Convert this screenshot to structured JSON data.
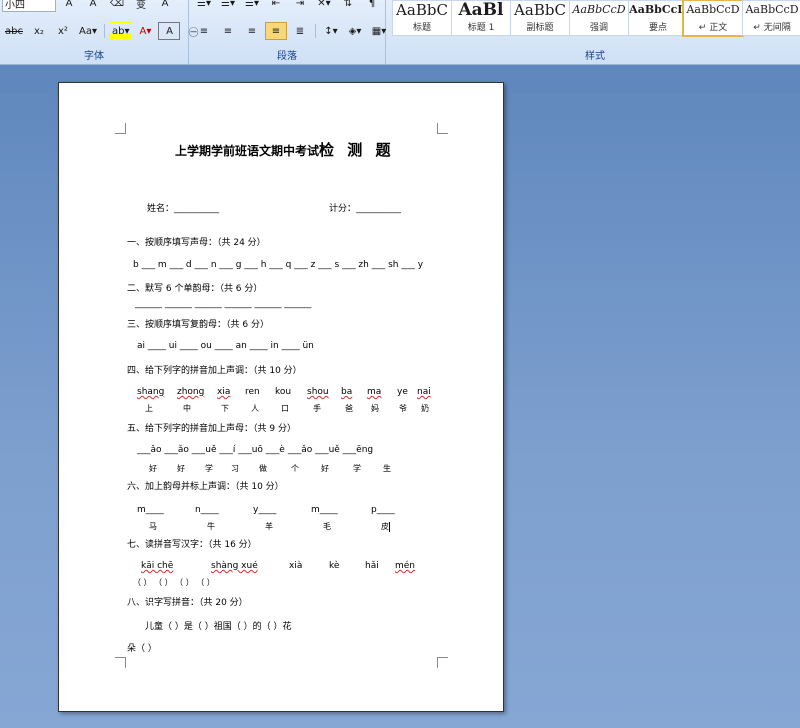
{
  "ribbon": {
    "font_group": {
      "label": "字体",
      "font_size": "小四"
    },
    "paragraph_group": {
      "label": "段落"
    },
    "styles_group": {
      "label": "样式",
      "items": [
        {
          "sample": "AaBbC",
          "name": "标题"
        },
        {
          "sample": "AaBl",
          "name": "标题 1"
        },
        {
          "sample": "AaBbC",
          "name": "副标题"
        },
        {
          "sample": "AaBbCcD",
          "name": "强调"
        },
        {
          "sample": "AaBbCcD",
          "name": "要点"
        },
        {
          "sample": "AaBbCcD",
          "name": "↵ 正文"
        },
        {
          "sample": "AaBbCcD",
          "name": "↵ 无间隔"
        }
      ]
    }
  },
  "document": {
    "title_main": "上学期学前班语文期中考试",
    "title_emph": "检 测 题",
    "name_label": "姓名：__________",
    "score_label": "计分：__________",
    "s1_heading": "一、按顺序填写声母：（共 24 分）",
    "s1_line": "b ___ m ___ d ___ n ___ g ___ h ___ q ___ z ___ s ___ zh ___ sh ___ y",
    "s2_heading": "二、默写 6 个单韵母：（共 6 分）",
    "s2_blanks": "______    ______    ______    ______    ______    ______",
    "s3_heading": "三、按顺序填写复韵母：（共 6 分）",
    "s3_line": "ai ____ ui ____ ou ____ an ____ in ____ ün",
    "s4_heading": "四、给下列字的拼音加上声调：（共 10 分）",
    "s4_pinyin": [
      "shang",
      "zhong",
      "xia",
      "ren",
      "kou",
      "shou",
      "ba",
      "ma",
      "ye",
      "nai"
    ],
    "s4_chars": [
      "上",
      "中",
      "下",
      "人",
      "口",
      "手",
      "爸",
      "妈",
      "爷",
      "奶"
    ],
    "s5_heading": "五、给下列字的拼音加上声母：（共 9 分）",
    "s5_line": "___ǎo ___ǎo ___uě ___í ___uō ___è ___ǎo ___uě ___ēng",
    "s5_chars": [
      "好",
      "好",
      "学",
      "习",
      "做",
      "个",
      "好",
      "学",
      "生"
    ],
    "s6_heading": "六、加上韵母并标上声调：（共 10 分）",
    "s6_items": [
      "m____",
      "n____",
      "y____",
      "m____",
      "p____"
    ],
    "s6_chars": [
      "马",
      "牛",
      "羊",
      "毛",
      "皮"
    ],
    "s7_heading": "七、读拼音写汉字：（共 16 分）",
    "s7_pinyin": [
      "kāi  chē",
      "shàng  xué",
      "xià",
      "kè",
      "hǎi",
      "mén"
    ],
    "s7_parens": "（          ）      （          ）      （          ）      （          ）",
    "s8_heading": "八、识字写拼音：（共 20 分）",
    "s8_line1": "儿童（          ）是（       ）祖国（          ）的（       ）花",
    "s8_line2": "朵（          ）"
  }
}
